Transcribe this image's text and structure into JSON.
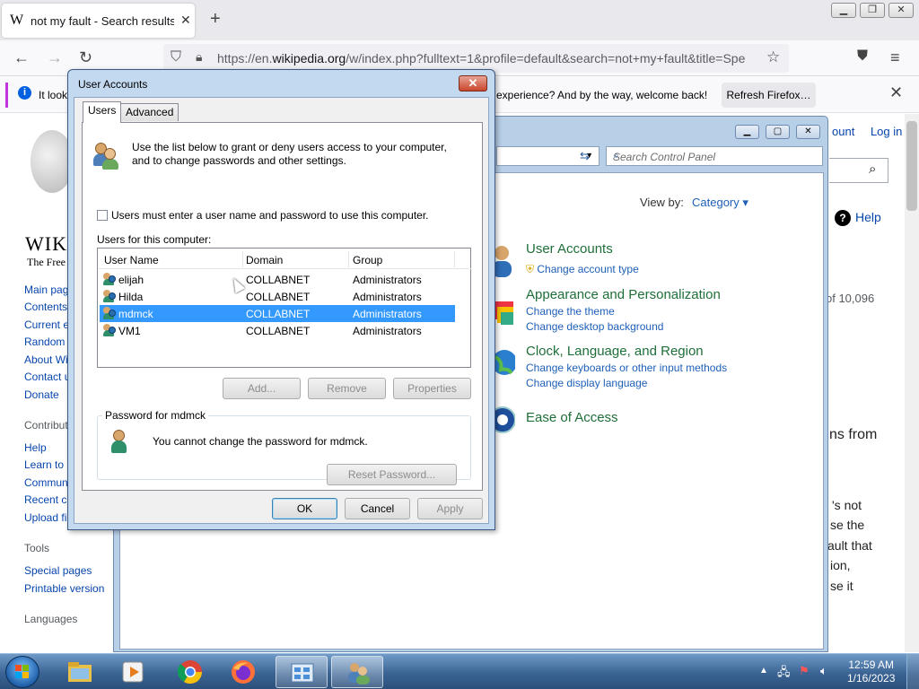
{
  "firefox": {
    "tab_title": "not my fault - Search results - W",
    "tab_favicon": "W",
    "url_host_prefix": "https://en.",
    "url_host": "wikipedia.org",
    "url_path": "/w/index.php?fulltext=1&profile=default&search=not+my+fault&title=Spe",
    "notice_text_left": "It look",
    "notice_text_right": "experience? And by the way, welcome back!",
    "refresh_button": "Refresh Firefox…"
  },
  "wikipedia": {
    "sidebar_links": [
      "Main pag",
      "Contents",
      "Current e",
      "Random",
      "About Wi",
      "Contact u",
      "Donate"
    ],
    "contribute_heading": "Contribut",
    "contribute_links": [
      "Help",
      "Learn to",
      "Commun",
      "Recent c",
      "Upload fi"
    ],
    "tools_heading": "Tools",
    "tools_links": [
      "Special pages",
      "Printable version"
    ],
    "languages_heading": "Languages",
    "logo_name": "WIK",
    "logo_sub": "The Free",
    "account_link": "ount",
    "login_link": "Log in",
    "help_label": "Help",
    "result_count": "of 10,096",
    "text_lines": [
      "ns from",
      "'s not",
      "se the",
      "ault that",
      "ion,",
      "se it"
    ]
  },
  "control_panel": {
    "search_placeholder": "Search Control Panel",
    "view_by_label": "View by:",
    "view_by_value": "Category",
    "categories": [
      {
        "title": "User Accounts",
        "links": [
          "Change account type"
        ]
      },
      {
        "title": "Appearance and Personalization",
        "links": [
          "Change the theme",
          "Change desktop background"
        ]
      },
      {
        "title": "Clock, Language, and Region",
        "links": [
          "Change keyboards or other input methods",
          "Change display language"
        ]
      },
      {
        "title": "Ease of Access",
        "links": []
      }
    ]
  },
  "user_accounts": {
    "title": "User Accounts",
    "tabs": [
      "Users",
      "Advanced"
    ],
    "intro": "Use the list below to grant or deny users access to your computer, and to change passwords and other settings.",
    "require_login_label": "Users must enter a user name and password to use this computer.",
    "require_login_checked": false,
    "users_label": "Users for this computer:",
    "columns": [
      "User Name",
      "Domain",
      "Group"
    ],
    "users": [
      {
        "name": "elijah",
        "domain": "COLLABNET",
        "group": "Administrators"
      },
      {
        "name": "Hilda",
        "domain": "COLLABNET",
        "group": "Administrators"
      },
      {
        "name": "mdmck",
        "domain": "COLLABNET",
        "group": "Administrators"
      },
      {
        "name": "VM1",
        "domain": "COLLABNET",
        "group": "Administrators"
      }
    ],
    "selected_user": "mdmck",
    "buttons": {
      "add": "Add...",
      "remove": "Remove",
      "properties": "Properties"
    },
    "password_group_label": "Password for mdmck",
    "password_message": "You cannot change the password for mdmck.",
    "reset_password": "Reset Password...",
    "ok": "OK",
    "cancel": "Cancel",
    "apply": "Apply"
  },
  "taskbar": {
    "time": "12:59 AM",
    "date": "1/16/2023",
    "apps": [
      "windows-explorer-icon",
      "media-player-icon",
      "chrome-icon",
      "firefox-icon",
      "control-panel-icon",
      "user-accounts-icon"
    ]
  }
}
